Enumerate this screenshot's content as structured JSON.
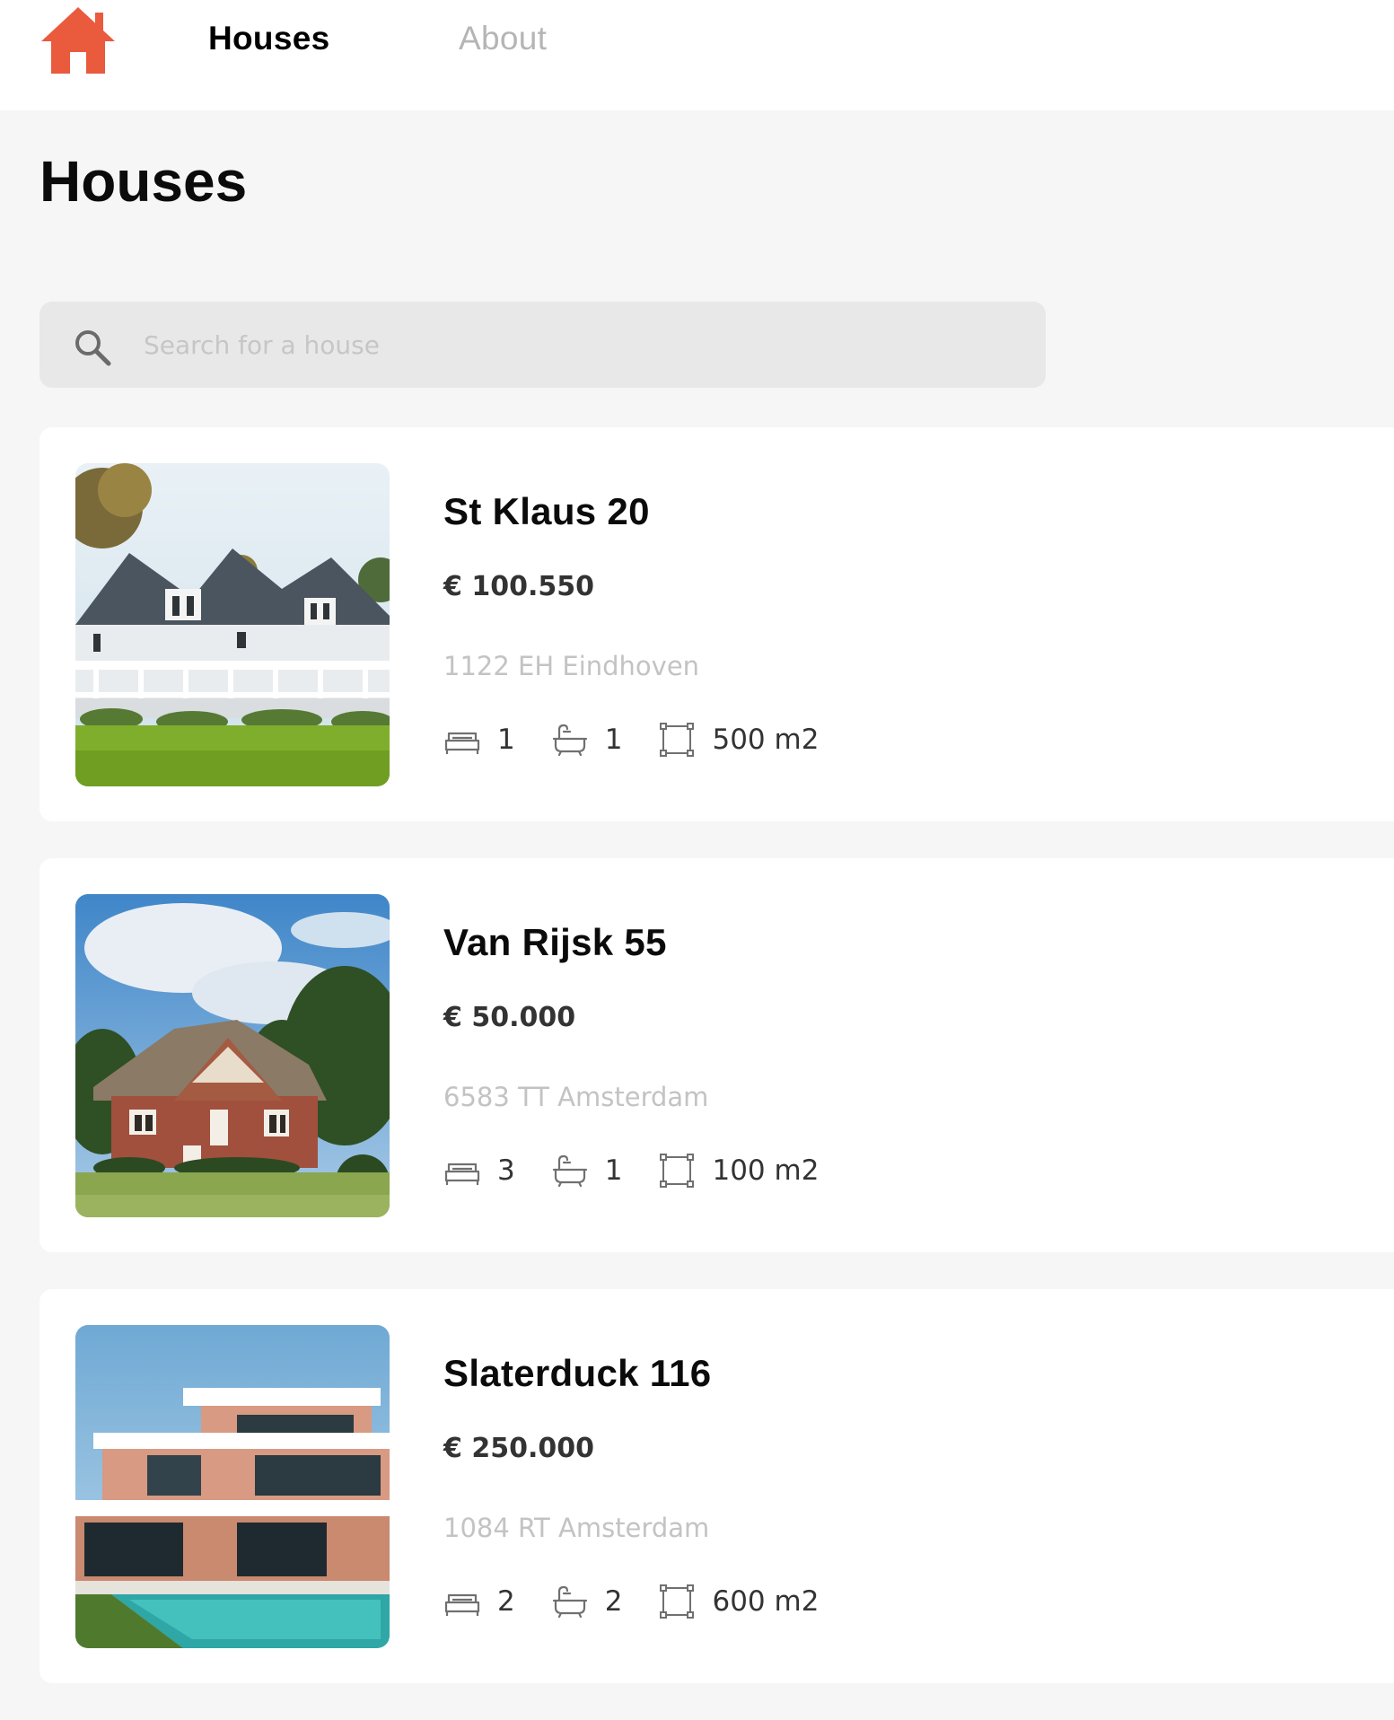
{
  "header": {
    "nav": {
      "houses_label": "Houses",
      "about_label": "About"
    },
    "logo_icon": "home-icon",
    "accent_color": "#ea5a3d"
  },
  "page": {
    "title": "Houses"
  },
  "search": {
    "placeholder": "Search for a house",
    "value": "",
    "icon": "search-icon"
  },
  "icons": {
    "bedrooms": "bed-icon",
    "bathrooms": "bath-icon",
    "size": "area-icon"
  },
  "houses": [
    {
      "title": "St Klaus 20",
      "price": "€ 100.550",
      "address": "1122 EH Eindhoven",
      "bedrooms": "1",
      "bathrooms": "1",
      "size": "500 m2"
    },
    {
      "title": "Van Rijsk 55",
      "price": "€ 50.000",
      "address": "6583 TT Amsterdam",
      "bedrooms": "3",
      "bathrooms": "1",
      "size": "100 m2"
    },
    {
      "title": "Slaterduck 116",
      "price": "€ 250.000",
      "address": "1084 RT Amsterdam",
      "bedrooms": "2",
      "bathrooms": "2",
      "size": "600 m2"
    }
  ]
}
